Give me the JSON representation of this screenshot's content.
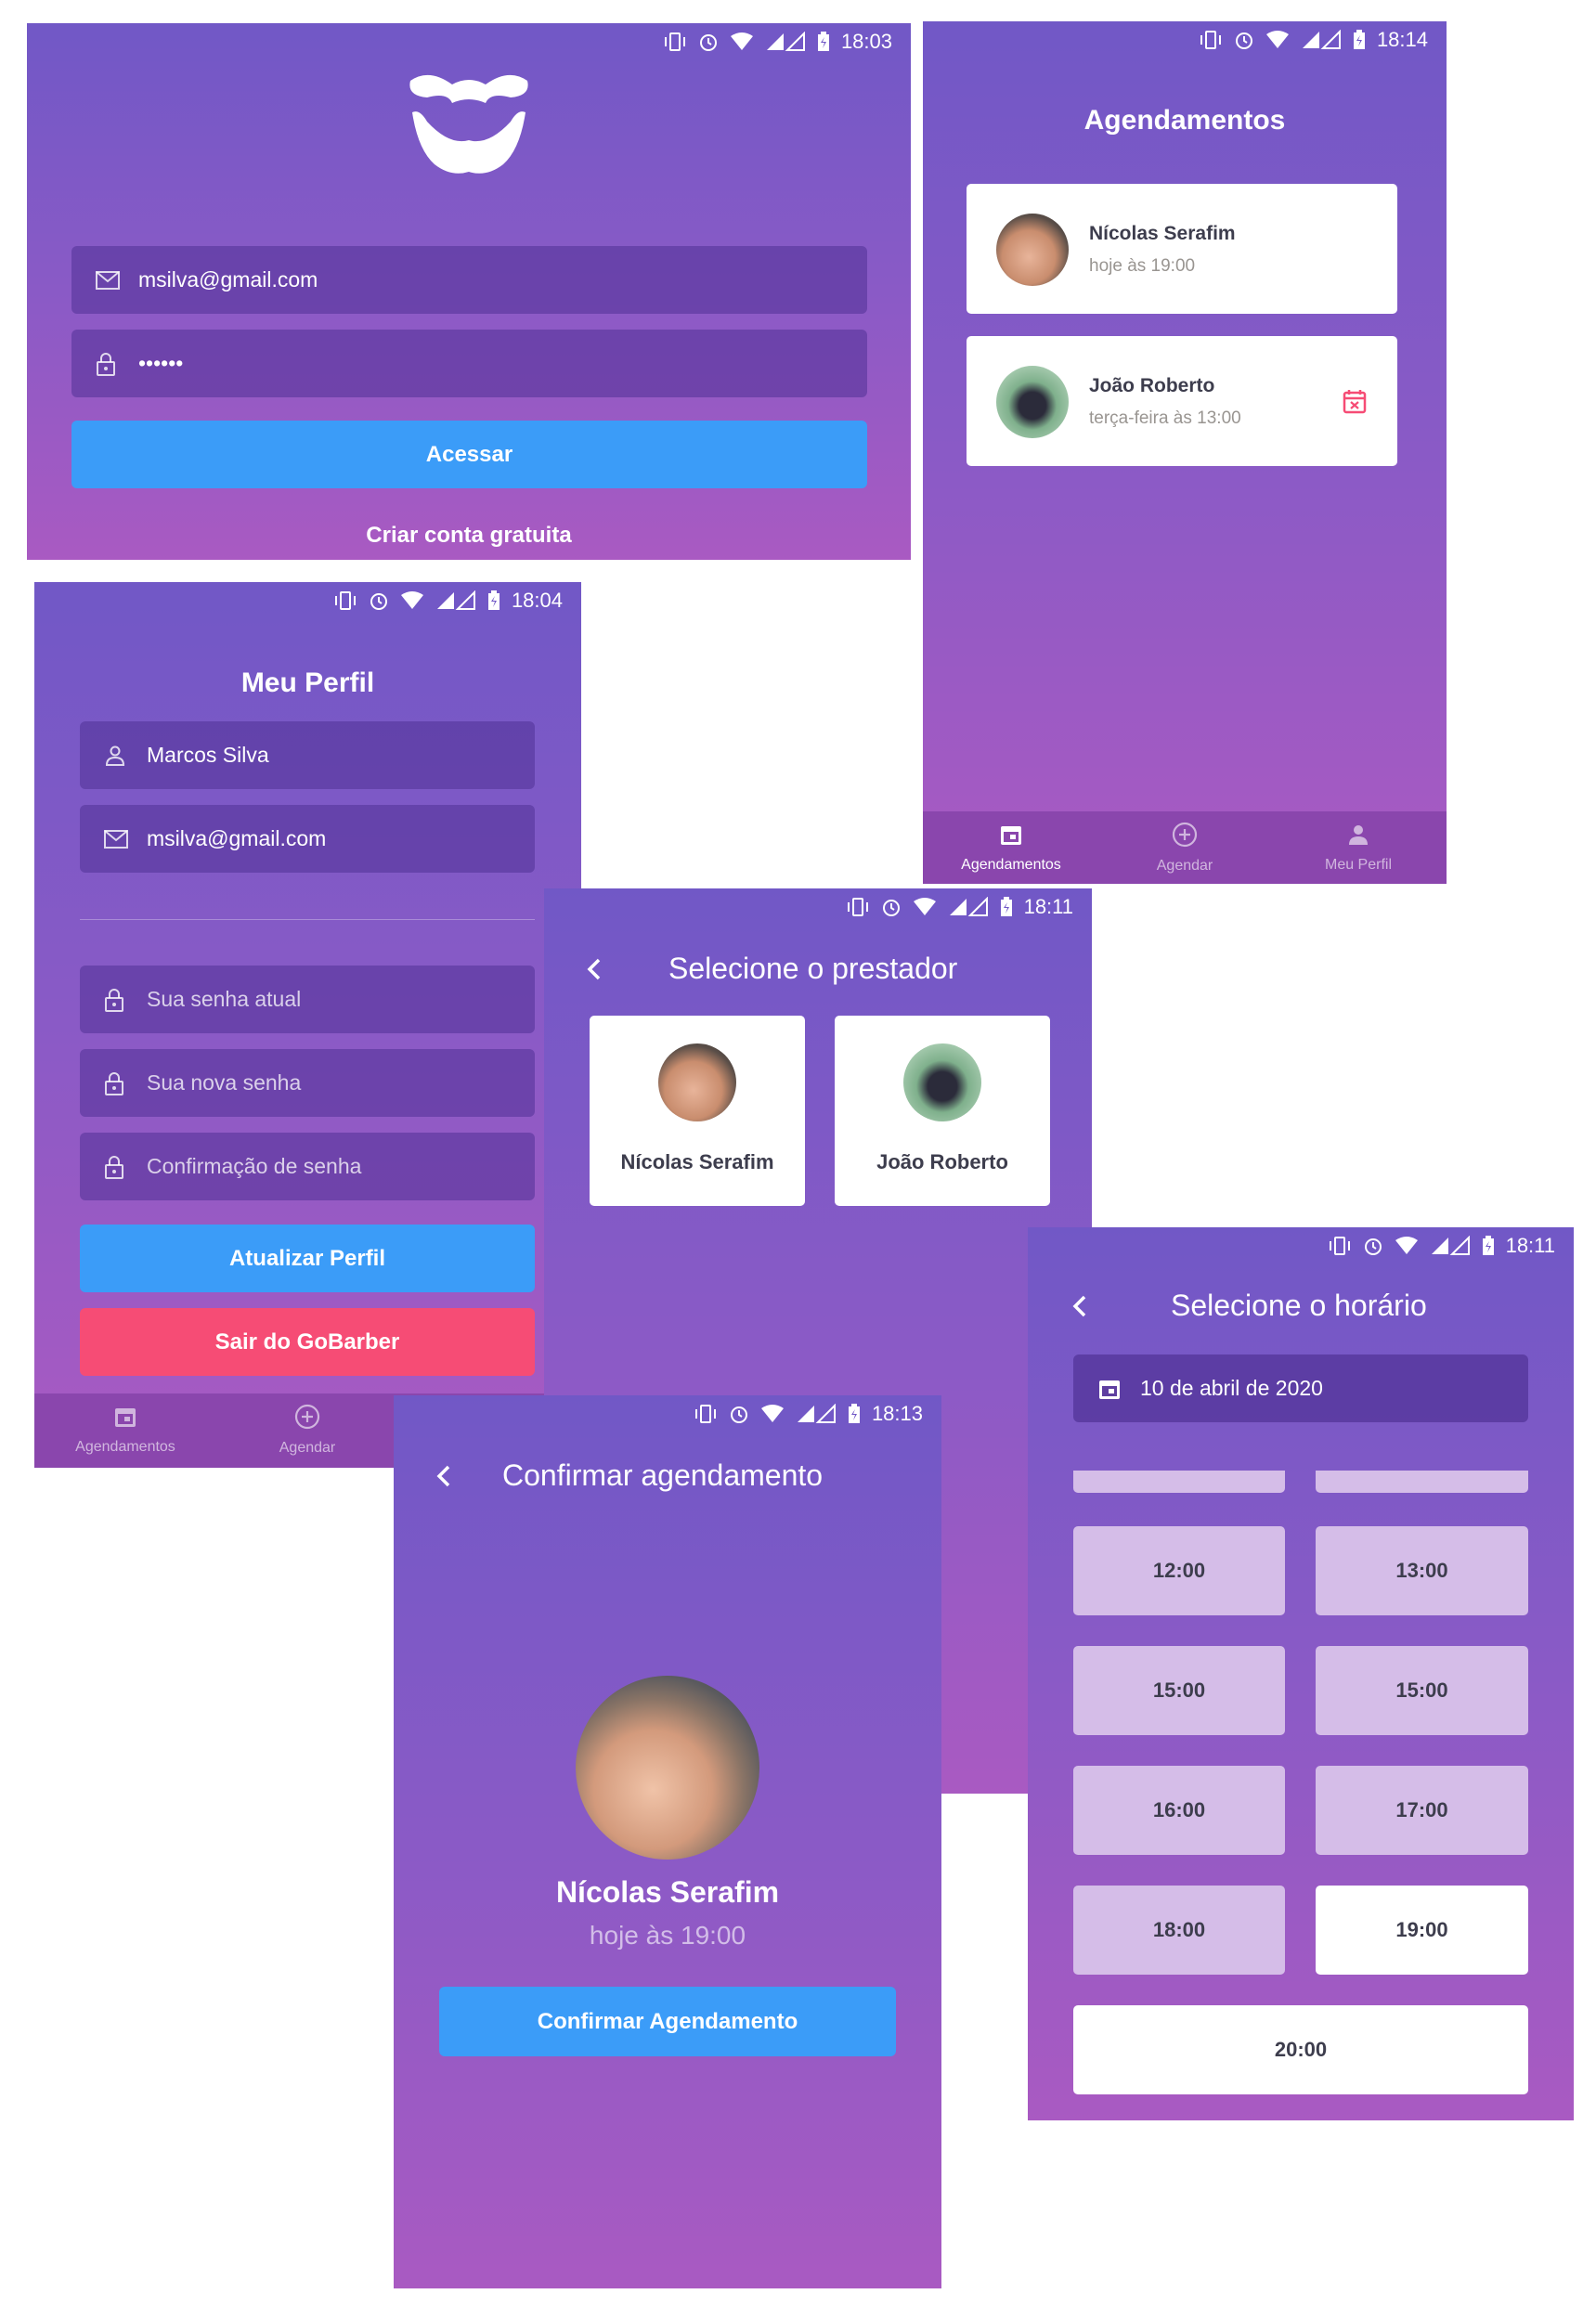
{
  "status_times": {
    "login": "18:03",
    "appointments": "18:14",
    "profile": "18:04",
    "provider": "18:11",
    "schedule": "18:11",
    "confirm": "18:13"
  },
  "login": {
    "email_value": "msilva@gmail.com",
    "password_value": "••••••",
    "submit_label": "Acessar",
    "create_account_label": "Criar conta gratuita"
  },
  "appointments": {
    "title": "Agendamentos",
    "items": [
      {
        "name": "Nícolas Serafim",
        "time": "hoje às 19:00",
        "cancel_icon": false
      },
      {
        "name": "João Roberto",
        "time": "terça-feira às 13:00",
        "cancel_icon": true
      }
    ],
    "tabs": [
      {
        "label": "Agendamentos",
        "icon": "calendar-icon",
        "active": true
      },
      {
        "label": "Agendar",
        "icon": "add-circle-icon",
        "active": false
      },
      {
        "label": "Meu Perfil",
        "icon": "person-icon",
        "active": false
      }
    ]
  },
  "profile": {
    "title": "Meu Perfil",
    "name_value": "Marcos Silva",
    "email_value": "msilva@gmail.com",
    "old_password_placeholder": "Sua senha atual",
    "new_password_placeholder": "Sua nova senha",
    "confirm_password_placeholder": "Confirmação de senha",
    "update_label": "Atualizar Perfil",
    "logout_label": "Sair do GoBarber",
    "tabs": [
      {
        "label": "Agendamentos"
      },
      {
        "label": "Agendar"
      }
    ]
  },
  "provider": {
    "title": "Selecione o prestador",
    "providers": [
      {
        "name": "Nícolas Serafim"
      },
      {
        "name": "João Roberto"
      }
    ]
  },
  "schedule": {
    "title": "Selecione o horário",
    "date": "10 de abril de 2020",
    "slots": [
      {
        "time": "12:00",
        "selected": false
      },
      {
        "time": "13:00",
        "selected": false
      },
      {
        "time": "15:00",
        "selected": false
      },
      {
        "time": "15:00",
        "selected": false
      },
      {
        "time": "16:00",
        "selected": false
      },
      {
        "time": "17:00",
        "selected": false
      },
      {
        "time": "18:00",
        "selected": false
      },
      {
        "time": "19:00",
        "selected": true
      },
      {
        "time": "20:00",
        "selected": true
      }
    ]
  },
  "confirm": {
    "title": "Confirmar agendamento",
    "provider_name": "Nícolas Serafim",
    "time": "hoje às 19:00",
    "button_label": "Confirmar Agendamento"
  },
  "colors": {
    "gradient_top": "#7158c6",
    "gradient_bottom": "#a95ac2",
    "primary_button": "#3b9cf8",
    "danger_button": "#f64c75",
    "tab_bar": "#8a46ad",
    "slot_idle": "#d5bde8",
    "cancel_icon": "#f64c75"
  }
}
